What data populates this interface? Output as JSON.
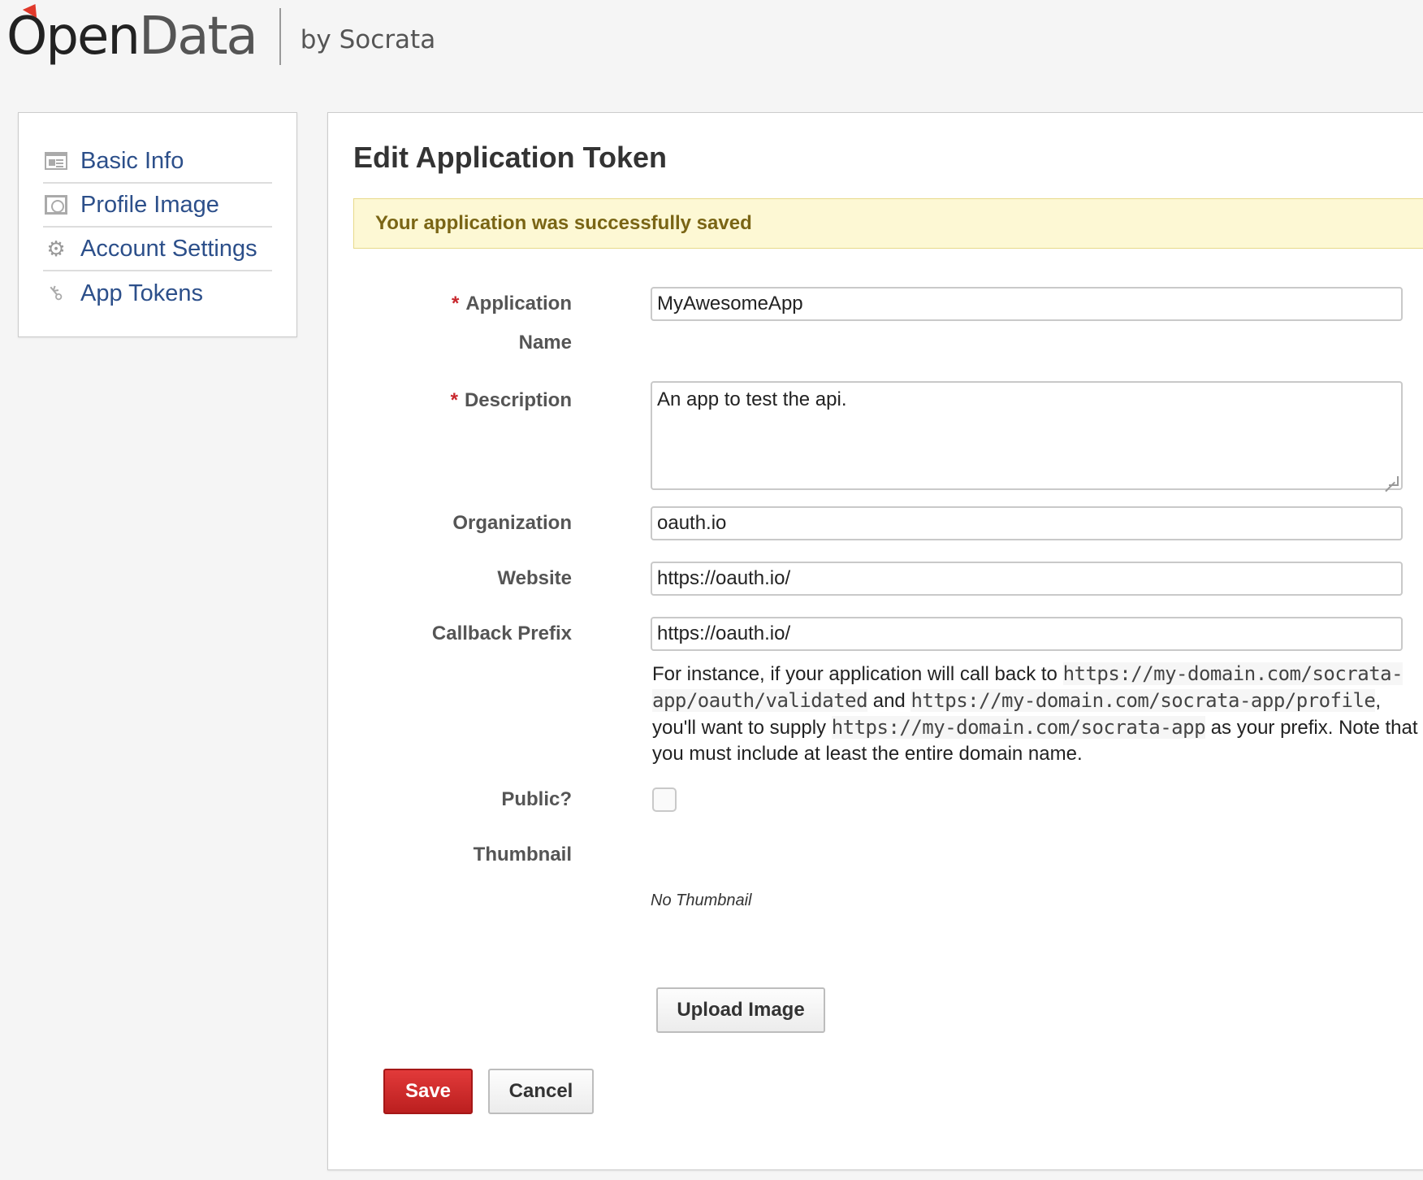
{
  "header": {
    "logo_open": "Open",
    "logo_data": "Data",
    "logo_by": "by Socrata"
  },
  "sidebar": {
    "items": [
      {
        "label": "Basic Info",
        "icon": "id-card-icon"
      },
      {
        "label": "Profile Image",
        "icon": "picture-icon"
      },
      {
        "label": "Account Settings",
        "icon": "gear-icon"
      },
      {
        "label": "App Tokens",
        "icon": "key-icon"
      }
    ]
  },
  "form": {
    "title": "Edit Application Token",
    "alert": "Your application was successfully saved",
    "required_marker": "*",
    "labels": {
      "app_name_line1": "Application",
      "app_name_line2": "Name",
      "description": "Description",
      "organization": "Organization",
      "website": "Website",
      "callback_prefix": "Callback Prefix",
      "public": "Public?",
      "thumbnail": "Thumbnail"
    },
    "values": {
      "app_name": "MyAwesomeApp",
      "description": "An app to test the api.",
      "organization": "oauth.io",
      "website": "https://oauth.io/",
      "callback_prefix": "https://oauth.io/",
      "public": false
    },
    "hint": {
      "t1": "For instance, if your application will call back to ",
      "c1": "https://my-domain.com/socrata-app/oauth/validated",
      "t2": " and ",
      "c2": "https://my-domain.com/socrata-app/profile",
      "t3": ", you'll want to supply ",
      "c3": "https://my-domain.com/socrata-app",
      "t4": " as your prefix. Note that you must include at least the entire domain name."
    },
    "no_thumbnail": "No Thumbnail",
    "upload_label": "Upload Image",
    "save_label": "Save",
    "cancel_label": "Cancel"
  },
  "colors": {
    "link": "#2c4f8a",
    "alert_bg": "#fdf8d4",
    "alert_text": "#7a6515",
    "save_button": "#c8262c",
    "logo_accent": "#e0392b"
  }
}
